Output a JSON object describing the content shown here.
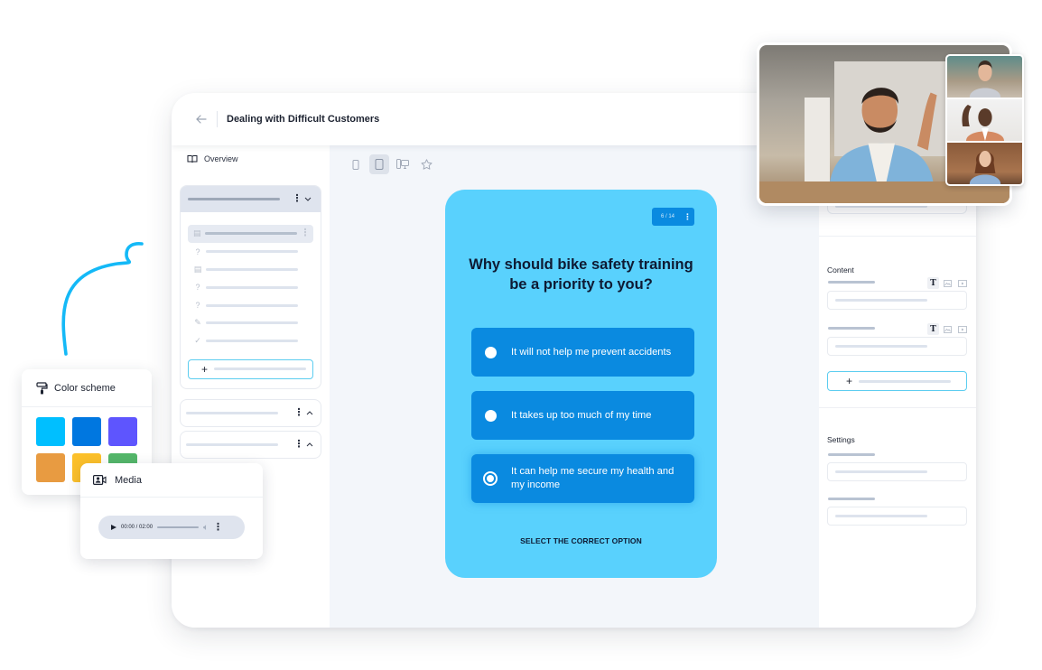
{
  "header": {
    "title": "Dealing with Difficult Customers",
    "back_icon": "arrow-left-icon"
  },
  "sidebar": {
    "overview_label": "Overview",
    "overview_icon": "book-icon",
    "lessons": [
      {
        "icon": "document-icon",
        "glyph": "▤",
        "active": true
      },
      {
        "icon": "question-icon",
        "glyph": "?",
        "active": false
      },
      {
        "icon": "document-icon",
        "glyph": "▤",
        "active": false
      },
      {
        "icon": "question-icon",
        "glyph": "?",
        "active": false
      },
      {
        "icon": "question-icon",
        "glyph": "?",
        "active": false
      },
      {
        "icon": "pencil-icon",
        "glyph": "✎",
        "active": false
      },
      {
        "icon": "check-circle-icon",
        "glyph": "✓",
        "active": false
      }
    ],
    "add_symbol": "+"
  },
  "toolbar": {
    "devices": [
      {
        "name": "mobile",
        "active": false
      },
      {
        "name": "tablet",
        "active": true
      },
      {
        "name": "desktop",
        "active": false
      },
      {
        "name": "favorite",
        "active": false
      }
    ]
  },
  "quiz": {
    "counter": "6 / 14",
    "question": "Why should bike safety training be a priority to you?",
    "options": [
      {
        "label": "It will not help me prevent accidents",
        "selected": false
      },
      {
        "label": "It takes up too much of my time",
        "selected": false
      },
      {
        "label": "It can help me secure my health and my income",
        "selected": true
      }
    ],
    "instruction": "SELECT THE CORRECT OPTION",
    "colors": {
      "card": "#59d1fd",
      "option": "#0a8ae0",
      "text": "#0e1a33"
    }
  },
  "right_panel": {
    "content_title": "Content",
    "settings_title": "Settings",
    "text_type_glyph": "T",
    "add_symbol": "+"
  },
  "color_scheme": {
    "title": "Color scheme",
    "swatches": [
      "#00bfff",
      "#0077e0",
      "#5e55fe",
      "#e89b41",
      "#fcc02a",
      "#54b76a"
    ]
  },
  "media": {
    "title": "Media",
    "time": "00:00 / 02:00"
  },
  "video_call": {
    "participants": 4
  }
}
